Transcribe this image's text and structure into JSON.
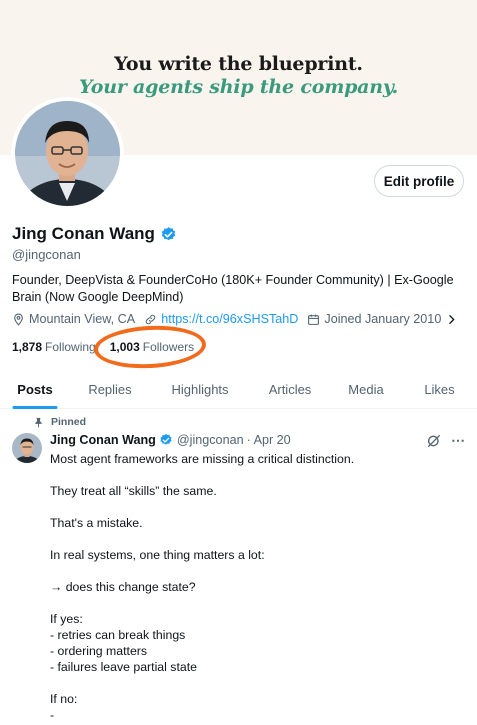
{
  "banner": {
    "line1": "You write the blueprint.",
    "line2": "Your agents ship the company."
  },
  "profile": {
    "edit_label": "Edit profile",
    "name": "Jing Conan Wang",
    "handle": "@jingconan",
    "bio": "Founder, DeepVista & FounderCoHo (180K+ Founder Community) | Ex-Google Brain (Now Google DeepMind)",
    "location": "Mountain View, CA",
    "link": "https://t.co/96xSHSTahD",
    "joined": "Joined January 2010",
    "following_count": "1,878",
    "following_label": "Following",
    "followers_count": "1,003",
    "followers_label": "Followers"
  },
  "tabs": [
    {
      "label": "Posts"
    },
    {
      "label": "Replies"
    },
    {
      "label": "Highlights"
    },
    {
      "label": "Articles"
    },
    {
      "label": "Media"
    },
    {
      "label": "Likes"
    }
  ],
  "post": {
    "pinned_label": "Pinned",
    "author": "Jing Conan Wang",
    "handle": "@jingconan",
    "date": "· Apr 20",
    "lines": [
      "Most agent frameworks are missing a critical distinction.",
      "They treat all “skills” the same.",
      "That's a mistake.",
      "In real systems, one thing matters a lot:",
      "→ does this change state?",
      "If yes:",
      "- retries can break things",
      "- ordering matters",
      "- failures leave partial state",
      "If no:",
      "-"
    ]
  },
  "colors": {
    "accent": "#1d9bf0",
    "annotation": "#f26a1b",
    "banner_green": "#3a9a7e",
    "banner_bg": "#faf4ee"
  },
  "icons": [
    "location-icon",
    "link-icon",
    "calendar-icon",
    "chevron-right-icon",
    "verified-icon",
    "pin-icon",
    "grok-icon",
    "more-icon"
  ]
}
